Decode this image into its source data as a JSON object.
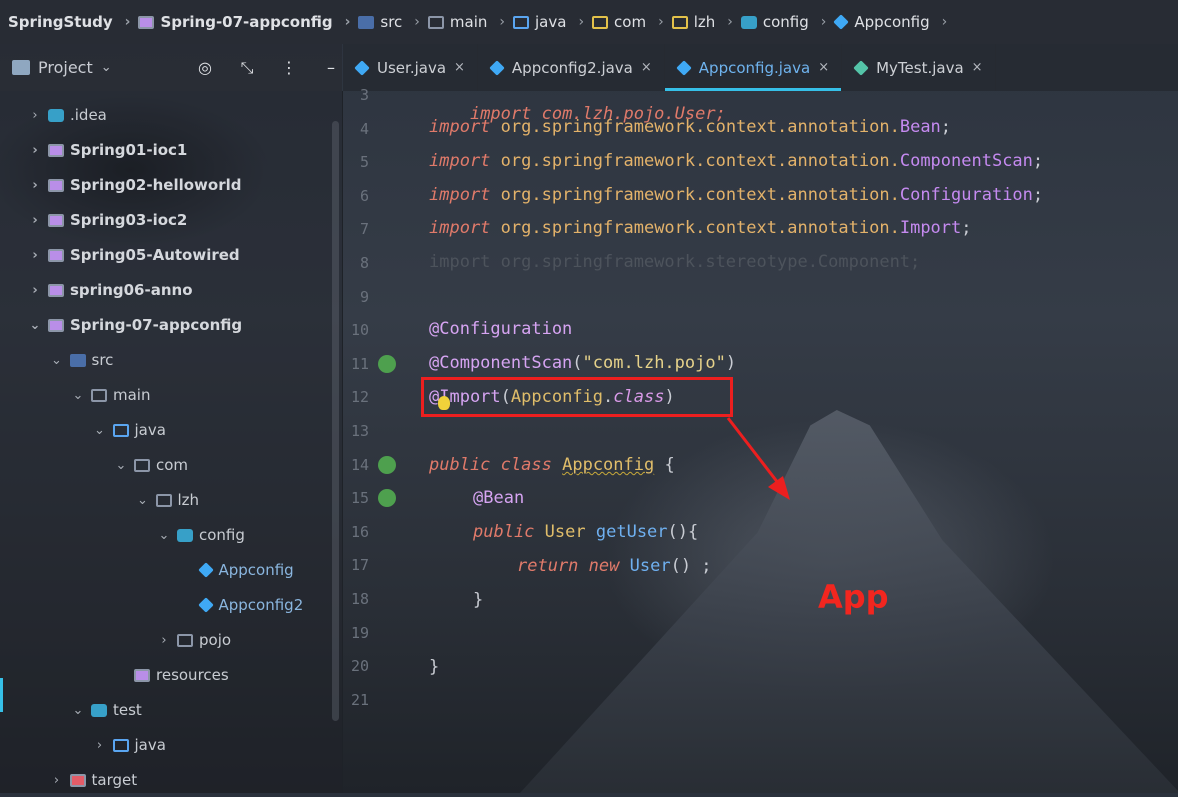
{
  "breadcrumb": [
    {
      "label": "SpringStudy",
      "icon": "",
      "bold": true
    },
    {
      "label": "Spring-07-appconfig",
      "icon": "module-folder-icon",
      "bold": true
    },
    {
      "label": "src",
      "icon": "source-folder-icon",
      "bold": false
    },
    {
      "label": "main",
      "icon": "folder-icon",
      "bold": false
    },
    {
      "label": "java",
      "icon": "blue-folder-icon",
      "bold": false
    },
    {
      "label": "com",
      "icon": "package-icon",
      "bold": false
    },
    {
      "label": "lzh",
      "icon": "package-icon",
      "bold": false
    },
    {
      "label": "config",
      "icon": "config-package-icon",
      "bold": false
    },
    {
      "label": "Appconfig",
      "icon": "java-class-icon",
      "bold": false
    }
  ],
  "project_panel": {
    "title": "Project",
    "tools": [
      "target-icon",
      "collapse-icon",
      "more-icon",
      "minimize-icon"
    ]
  },
  "tree": [
    {
      "label": ".idea",
      "indent": 0,
      "chev": "›",
      "icon": "cfg",
      "bold": false
    },
    {
      "label": "Spring01-ioc1",
      "indent": 0,
      "chev": "›",
      "icon": "purple",
      "bold": true
    },
    {
      "label": "Spring02-helloworld",
      "indent": 0,
      "chev": "›",
      "icon": "purple",
      "bold": true
    },
    {
      "label": "Spring03-ioc2",
      "indent": 0,
      "chev": "›",
      "icon": "purple",
      "bold": true
    },
    {
      "label": "Spring05-Autowired",
      "indent": 0,
      "chev": "›",
      "icon": "purple",
      "bold": true
    },
    {
      "label": "spring06-anno",
      "indent": 0,
      "chev": "›",
      "icon": "purple",
      "bold": true
    },
    {
      "label": "Spring-07-appconfig",
      "indent": 0,
      "chev": "⌄",
      "icon": "purple",
      "bold": true
    },
    {
      "label": "src",
      "indent": 1,
      "chev": "⌄",
      "icon": "src",
      "bold": false
    },
    {
      "label": "main",
      "indent": 2,
      "chev": "⌄",
      "icon": "folder",
      "bold": false
    },
    {
      "label": "java",
      "indent": 3,
      "chev": "⌄",
      "icon": "blue",
      "bold": false
    },
    {
      "label": "com",
      "indent": 4,
      "chev": "⌄",
      "icon": "folder",
      "bold": false
    },
    {
      "label": "lzh",
      "indent": 5,
      "chev": "⌄",
      "icon": "folder",
      "bold": false
    },
    {
      "label": "config",
      "indent": 6,
      "chev": "⌄",
      "icon": "cfg",
      "bold": false
    },
    {
      "label": "Appconfig",
      "indent": 7,
      "chev": "",
      "icon": "cube",
      "bold": false
    },
    {
      "label": "Appconfig2",
      "indent": 7,
      "chev": "",
      "icon": "cube",
      "bold": false
    },
    {
      "label": "pojo",
      "indent": 6,
      "chev": "›",
      "icon": "folder",
      "bold": false
    },
    {
      "label": "resources",
      "indent": 4,
      "chev": "",
      "icon": "purple",
      "bold": false
    },
    {
      "label": "test",
      "indent": 2,
      "chev": "⌄",
      "icon": "cfg",
      "bold": false
    },
    {
      "label": "java",
      "indent": 3,
      "chev": "›",
      "icon": "blue",
      "bold": false
    },
    {
      "label": "target",
      "indent": 1,
      "chev": "›",
      "icon": "red",
      "bold": false
    }
  ],
  "tabs": [
    {
      "label": "User.java",
      "active": false
    },
    {
      "label": "Appconfig2.java",
      "active": false
    },
    {
      "label": "Appconfig.java",
      "active": true
    },
    {
      "label": "MyTest.java",
      "active": false
    }
  ],
  "tab_close": "×",
  "line_numbers": [
    "3",
    "4",
    "5",
    "6",
    "7",
    "8",
    "9",
    "10",
    "11",
    "12",
    "13",
    "14",
    "15",
    "16",
    "17",
    "18",
    "19",
    "20",
    "21"
  ],
  "code": {
    "l3": "import com.lzh.pojo.User;",
    "import_kw": "import",
    "pkg_prefix": "org.springframework.context.annotation.",
    "l4_cls": "Bean",
    "l5_cls": "ComponentScan",
    "l6_cls": "Configuration",
    "l7_cls": "Import",
    "semi": ";",
    "l8": "import org.springframework.stereotype.Component;",
    "l10": "@Configuration",
    "l11_ann": "@ComponentScan",
    "l11_str": "\"com.lzh.pojo\"",
    "l12_ann": "@Import",
    "l12_cls": "Appconfig",
    "l12_dot": ".",
    "l12_kw": "class",
    "l14_kw1": "public",
    "l14_kw2": "class",
    "l14_name": "Appconfig",
    "l14_brace": "{",
    "l15": "@Bean",
    "l16_kw": "public",
    "l16_type": "User",
    "l16_fn": "getUser",
    "l16_rest": "(){",
    "l17_kw1": "return",
    "l17_kw2": "new",
    "l17_fn": "User",
    "l17_rest": "() ;",
    "l18": "}",
    "l20": "}"
  },
  "annotation_note": "App",
  "colors": {
    "accent": "#36c0e8",
    "highlight_box": "#ec1f1f",
    "keyword": "#e07a6a"
  }
}
